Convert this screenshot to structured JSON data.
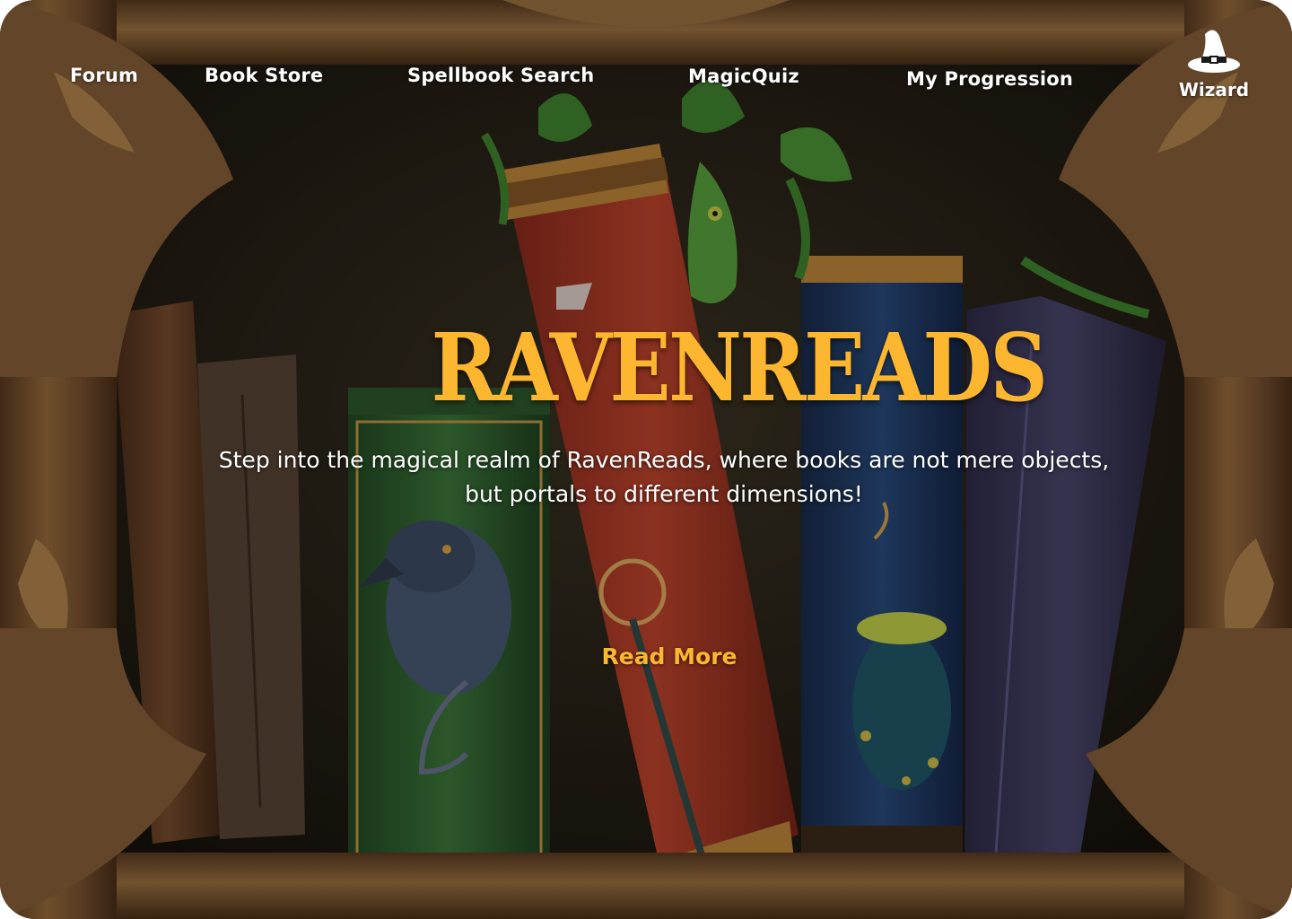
{
  "nav": {
    "items": [
      {
        "label": "Forum"
      },
      {
        "label": "Book Store"
      },
      {
        "label": "Spellbook Search"
      },
      {
        "label": "MagicQuiz"
      },
      {
        "label": "My Progression"
      }
    ],
    "profile_label": "Wizard",
    "profile_icon": "wizard-hat-icon"
  },
  "hero": {
    "logo_text": "RAVENREADS",
    "tagline_line1": "Step into the magical realm of RavenReads, where books are not mere objects,",
    "tagline_line2": "but portals to different dimensions!",
    "cta_label": "Read More"
  },
  "colors": {
    "accent": "#fdb62f",
    "nav_text": "#ffffff",
    "frame_wood": "#7a5530",
    "shelf_back": "#1e1a12"
  }
}
